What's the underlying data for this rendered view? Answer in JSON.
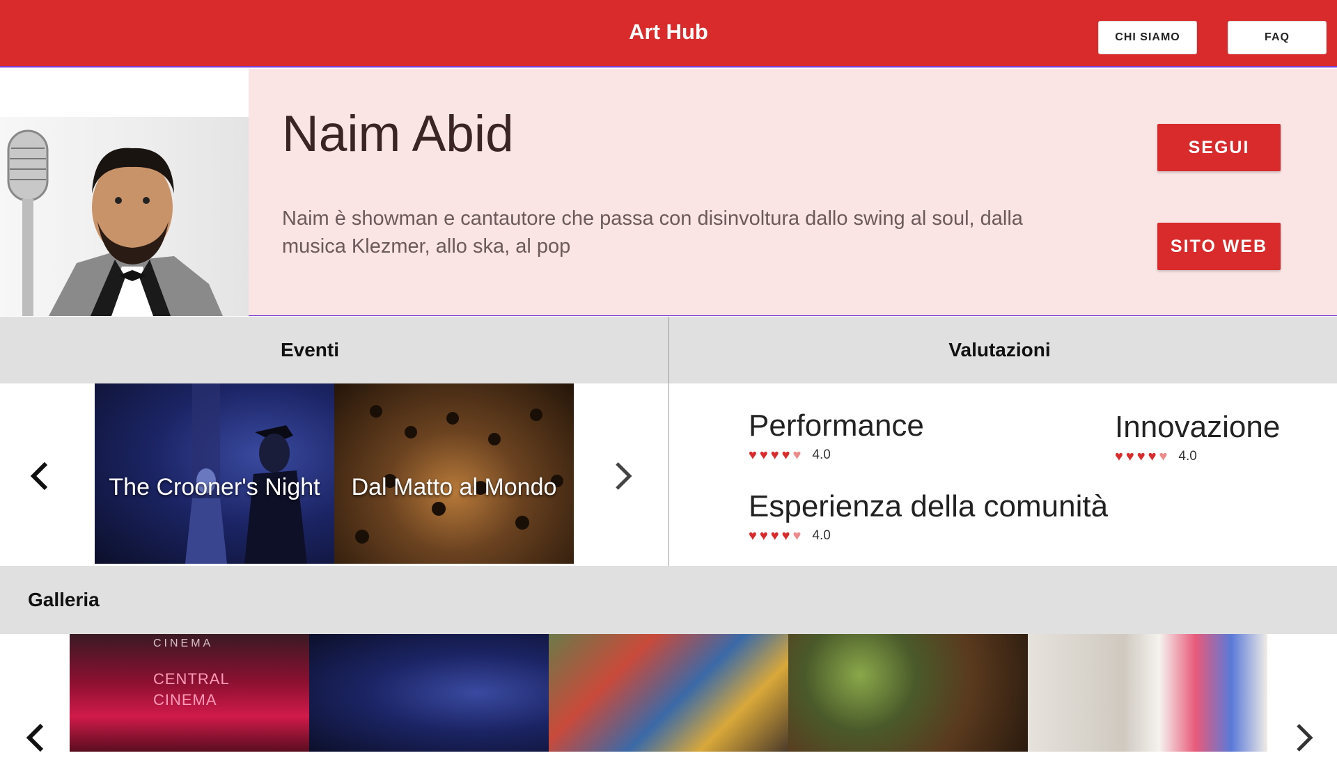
{
  "app": {
    "title": "Art Hub"
  },
  "nav": {
    "chi_siamo": "CHI SIAMO",
    "faq": "FAQ"
  },
  "profile": {
    "name": "Naim Abid",
    "bio": "Naim è showman e cantautore che passa con disinvoltura dallo swing al soul, dalla musica Klezmer, allo ska, al pop",
    "follow_label": "SEGUI",
    "website_label": "SITO WEB"
  },
  "events": {
    "header": "Eventi",
    "items": [
      {
        "title": "The Crooner's Night"
      },
      {
        "title": "Dal Matto al Mondo"
      }
    ]
  },
  "ratings": {
    "header": "Valutazioni",
    "items": [
      {
        "label": "Performance",
        "value": "4.0",
        "hearts": 4
      },
      {
        "label": "Innovazione",
        "value": "4.0",
        "hearts": 4
      },
      {
        "label": "Esperienza della comunità",
        "value": "4.0",
        "hearts": 4
      }
    ]
  },
  "gallery": {
    "header": "Galleria",
    "cinema_sign": "CINEMA",
    "cinema_neon": "CENTRAL CINEMA"
  },
  "icons": {
    "prev": "chevron-left-icon",
    "next": "chevron-right-icon",
    "heart": "heart-icon"
  },
  "colors": {
    "accent": "#d92b2b",
    "profile_bg": "#fbe4e4",
    "section_bg": "#e0e0e0"
  }
}
